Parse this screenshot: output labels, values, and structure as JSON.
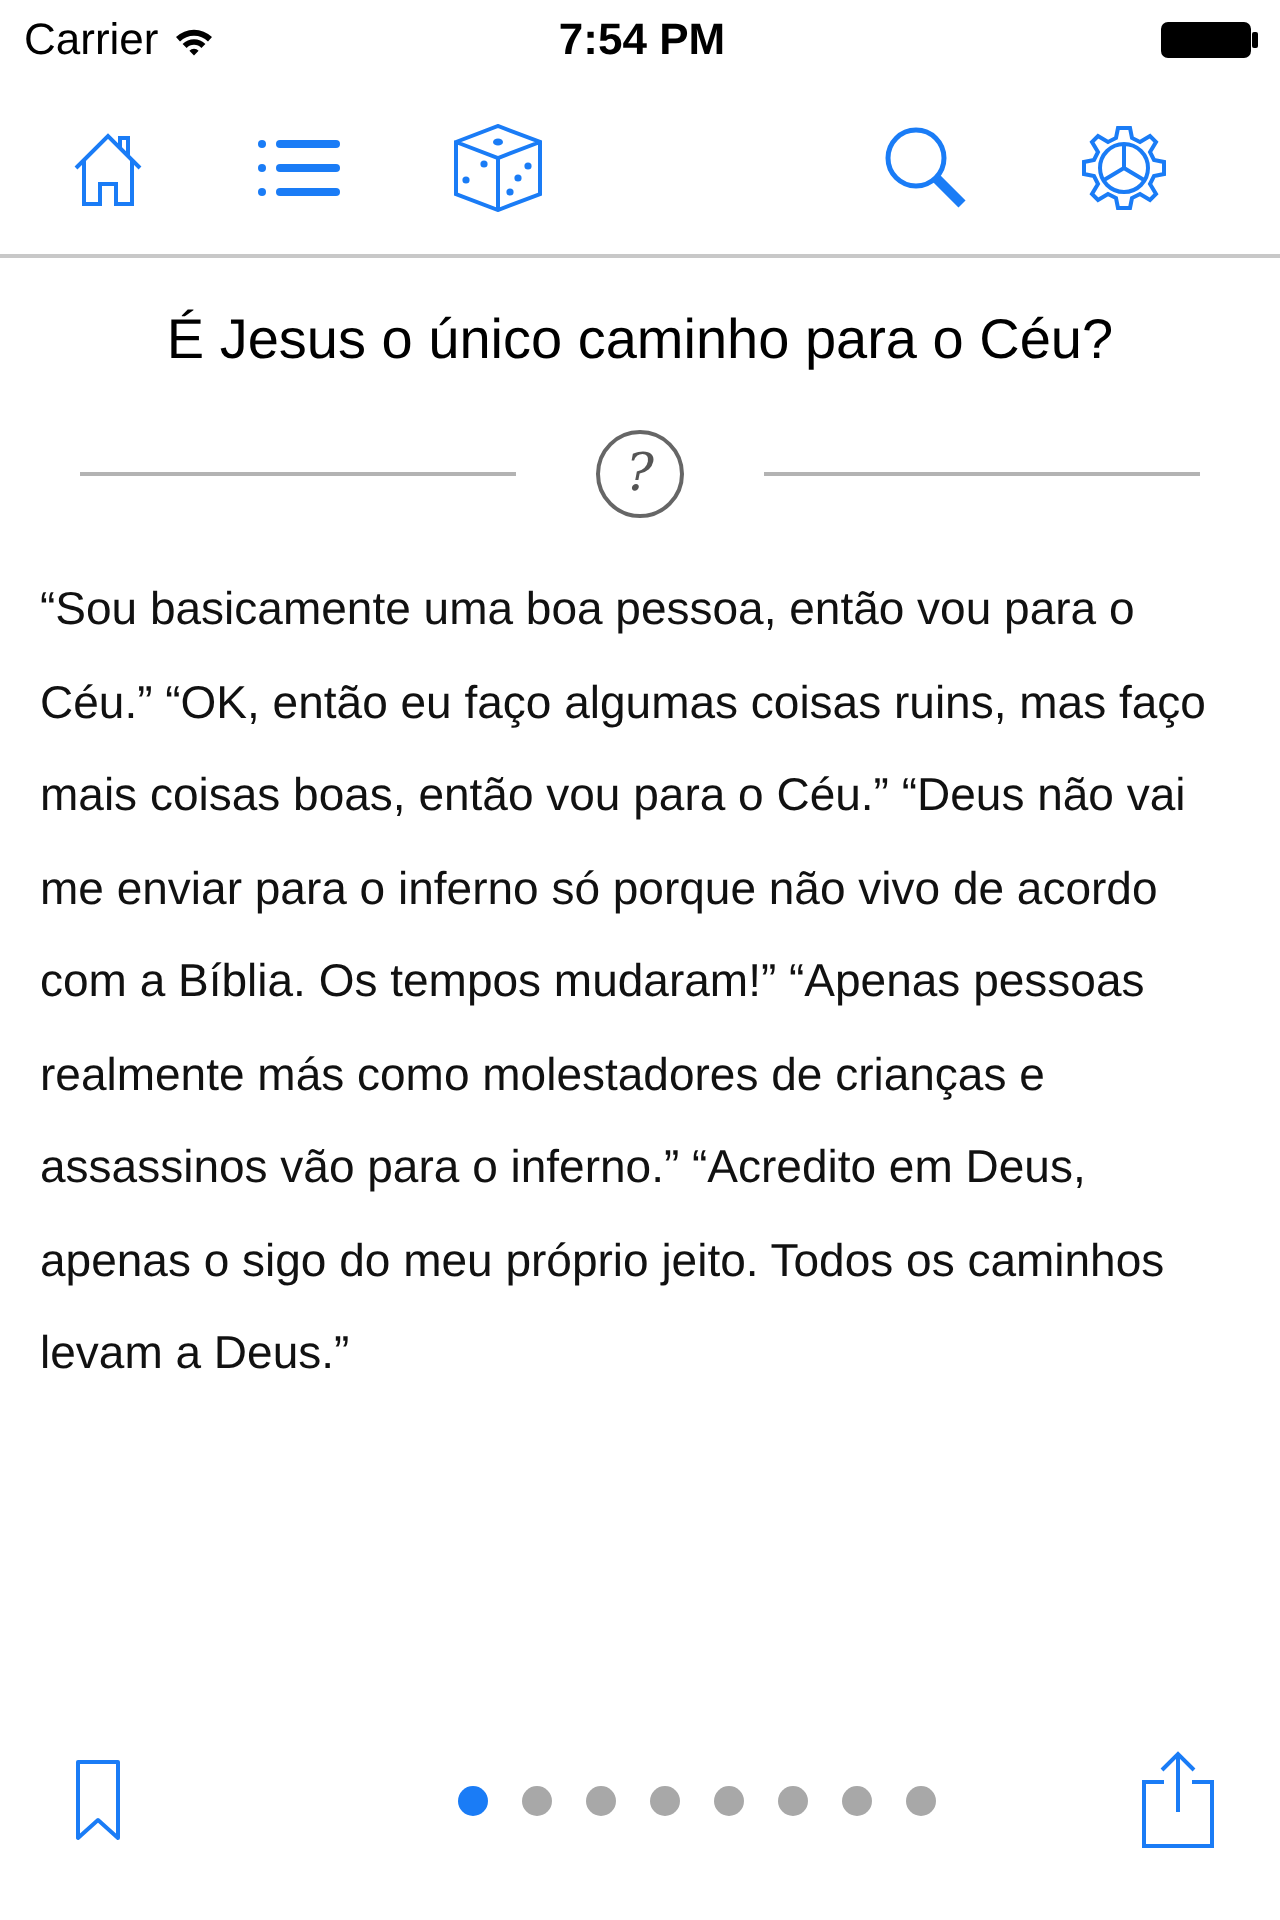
{
  "status_bar": {
    "carrier": "Carrier",
    "time": "7:54 PM"
  },
  "article": {
    "title": "É Jesus o único caminho para o Céu?",
    "divider_symbol": "?",
    "body": "“Sou basicamente uma boa pessoa, então vou para o Céu.” “OK, então eu faço algumas coisas ruins, mas faço mais coisas boas, então vou para o Céu.” “Deus não vai me enviar para o inferno só porque não vivo de acordo com a Bíblia. Os tempos mudaram!” “Apenas pessoas realmente más como molestadores de crianças e assassinos vão para o inferno.” “Acredito em Deus, apenas o sigo do meu próprio jeito. Todos os caminhos levam a Deus.”"
  },
  "pages": [
    {
      "selected": true
    },
    {
      "selected": false
    },
    {
      "selected": false
    },
    {
      "selected": false
    },
    {
      "selected": false
    },
    {
      "selected": false
    },
    {
      "selected": false
    },
    {
      "selected": false
    }
  ]
}
